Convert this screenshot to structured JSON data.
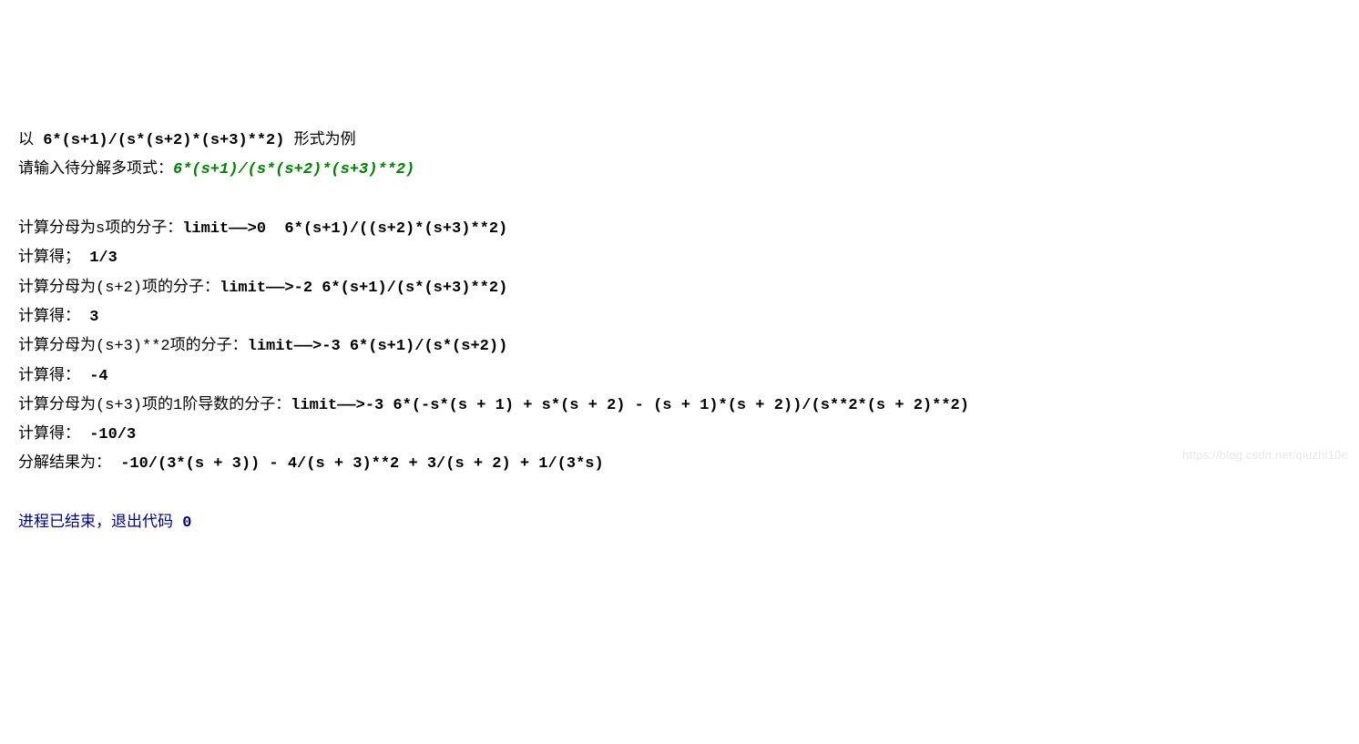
{
  "lines": {
    "l1_a": "以 ",
    "l1_b": "6*(s+1)/(s*(s+2)*(s+3)**2)",
    "l1_c": " 形式为例",
    "l2_a": "请输入待分解多项式：",
    "l2_b": "6*(s+1)/(s*(s+2)*(s+3)**2)",
    "l4_a": "计算分母为s项的分子：",
    "l4_b": "limit——>0  6*(s+1)/((s+2)*(s+3)**2)",
    "l5_a": "计算得； ",
    "l5_b": "1/3",
    "l6_a": "计算分母为(s+2)项的分子：",
    "l6_b": "limit——>-2 6*(s+1)/(s*(s+3)**2)",
    "l7_a": "计算得： ",
    "l7_b": "3",
    "l8_a": "计算分母为(s+3)**2项的分子：",
    "l8_b": "limit——>-3 6*(s+1)/(s*(s+2))",
    "l9_a": "计算得： ",
    "l9_b": "-4",
    "l10_a": "计算分母为(s+3)项的1阶导数的分子：",
    "l10_b": "limit——>-3 6*(-s*(s + 1) + s*(s + 2) - (s + 1)*(s + 2))/(s**2*(s + 2)**2)",
    "l11_a": "计算得： ",
    "l11_b": "-10/3",
    "l12_a": "分解结果为： ",
    "l12_b": "-10/(3*(s + 3)) - 4/(s + 3)**2 + 3/(s + 2) + 1/(3*s)",
    "l14_a": "进程已结束，退出代码 ",
    "l14_b": "0"
  },
  "watermark": "https://blog.csdn.net/qiuzhi10e"
}
